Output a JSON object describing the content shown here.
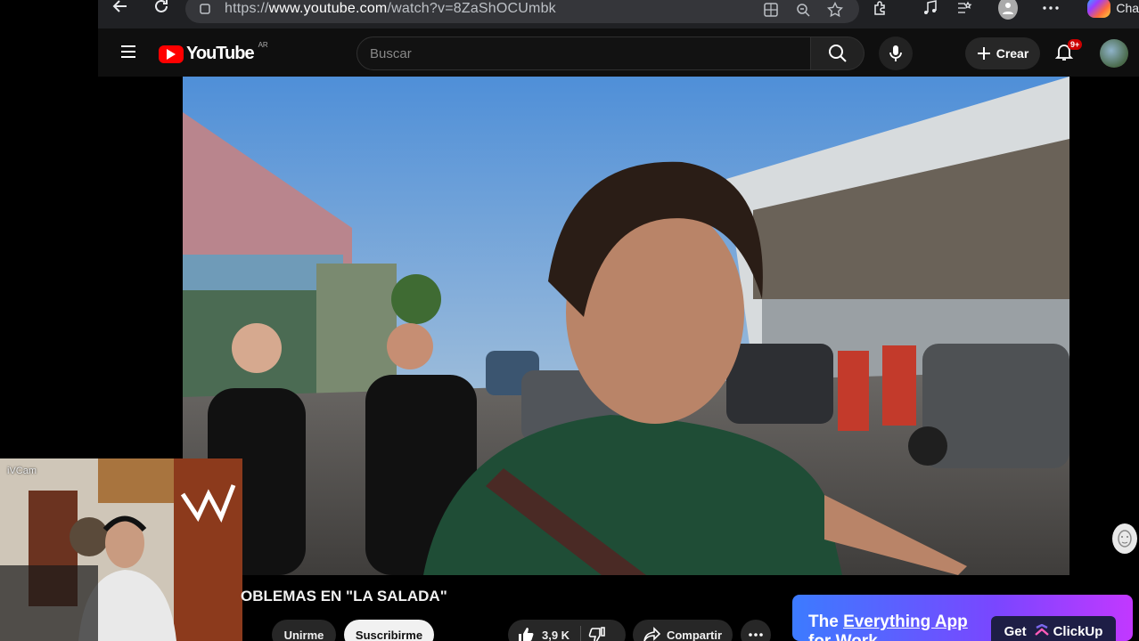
{
  "browser": {
    "url_prefix": "https://",
    "url_host": "www.youtube.com",
    "url_path": "/watch?v=8ZaShOCUmbk",
    "profile_label": "Cha"
  },
  "header": {
    "logo_text": "YouTube",
    "country_code": "AR",
    "search_placeholder": "Buscar",
    "create_label": "Crear",
    "notifications_badge": "9+"
  },
  "video": {
    "title": "OBLEMAS EN \"LA SALADA\""
  },
  "webcam": {
    "label": "iVCam"
  },
  "actions": {
    "join_label": "Unirme",
    "subscribe_label": "Suscribirme",
    "like_count": "3,9 K",
    "share_label": "Compartir"
  },
  "ad": {
    "headline_1": "The",
    "headline_link": "Everything App",
    "headline_2": "for Work",
    "cta_prefix": "Get",
    "cta_brand": "ClickUp"
  },
  "colors": {
    "brand_red": "#ff0000",
    "badge_red": "#cc0000",
    "ad_gradient_start": "#3c7bff",
    "ad_gradient_end": "#c238ff"
  }
}
